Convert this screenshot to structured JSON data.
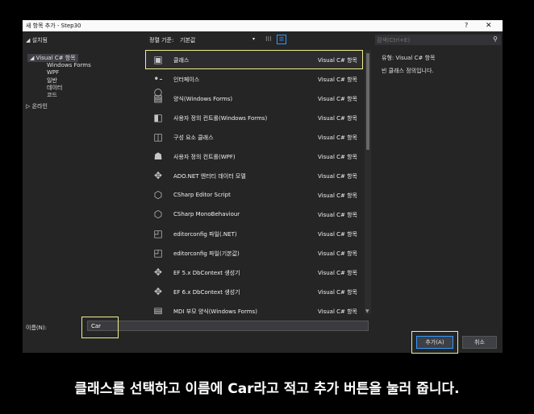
{
  "window": {
    "title": "새 항목 추가 - Step30",
    "help": "?",
    "close": "✕"
  },
  "left_panel": {
    "installed": "◢ 설치됨",
    "visual_csharp": "◢ Visual C# 항목",
    "children": [
      "Windows Forms",
      "WPF",
      "일반",
      "데이터",
      "코드"
    ],
    "online": "▷ 온라인"
  },
  "toolbar": {
    "sort_label": "정렬 기준:",
    "sort_value": "기본값",
    "sort_arrow": "▾",
    "grid": "⁝⁝⁝",
    "list": "☰"
  },
  "search": {
    "placeholder": "검색(Ctrl+E)",
    "icon": "⚲"
  },
  "items": [
    {
      "name": "클래스",
      "category": "Visual C# 항목",
      "icon": "class-icon",
      "glyph": "▣"
    },
    {
      "name": "인터페이스",
      "category": "Visual C# 항목",
      "icon": "interface-icon",
      "glyph": "•-○"
    },
    {
      "name": "양식(Windows Forms)",
      "category": "Visual C# 항목",
      "icon": "form-icon",
      "glyph": "▤"
    },
    {
      "name": "사용자 정의 컨트롤(Windows Forms)",
      "category": "Visual C# 항목",
      "icon": "user-control-icon",
      "glyph": "◧"
    },
    {
      "name": "구성 요소 클래스",
      "category": "Visual C# 항목",
      "icon": "component-class-icon",
      "glyph": "◫"
    },
    {
      "name": "사용자 정의 컨트롤(WPF)",
      "category": "Visual C# 항목",
      "icon": "wpf-control-icon",
      "glyph": "☗"
    },
    {
      "name": "ADO.NET 엔터티 데이터 모델",
      "category": "Visual C# 항목",
      "icon": "entity-model-icon",
      "glyph": "✥"
    },
    {
      "name": "CSharp Editor Script",
      "category": "Visual C# 항목",
      "icon": "unity-icon",
      "glyph": "⬡"
    },
    {
      "name": "CSharp MonoBehaviour",
      "category": "Visual C# 항목",
      "icon": "unity-icon",
      "glyph": "⬡"
    },
    {
      "name": "editorconfig 파일(.NET)",
      "category": "Visual C# 항목",
      "icon": "editorconfig-icon",
      "glyph": "◰"
    },
    {
      "name": "editorconfig 파일(기본값)",
      "category": "Visual C# 항목",
      "icon": "editorconfig-icon",
      "glyph": "◰"
    },
    {
      "name": "EF 5.x DbContext 생성기",
      "category": "Visual C# 항목",
      "icon": "ef-generator-icon",
      "glyph": "✥"
    },
    {
      "name": "EF 6.x DbContext 생성기",
      "category": "Visual C# 항목",
      "icon": "ef-generator-icon",
      "glyph": "✥"
    },
    {
      "name": "MDI 부모 양식(Windows Forms)",
      "category": "Visual C# 항목",
      "icon": "mdi-form-icon",
      "glyph": "▤"
    }
  ],
  "scrollbar": {
    "down": "▼"
  },
  "info": {
    "type_label": "유형:",
    "type_value": "Visual C# 항목",
    "description": "빈 클래스 정의입니다."
  },
  "name_field": {
    "label": "이름(N):",
    "value": "Car"
  },
  "buttons": {
    "add": "추가(A)",
    "cancel": "취소"
  },
  "caption": "클래스를 선택하고 이름에 Car라고 적고 추가 버튼을 눌러 줍니다."
}
